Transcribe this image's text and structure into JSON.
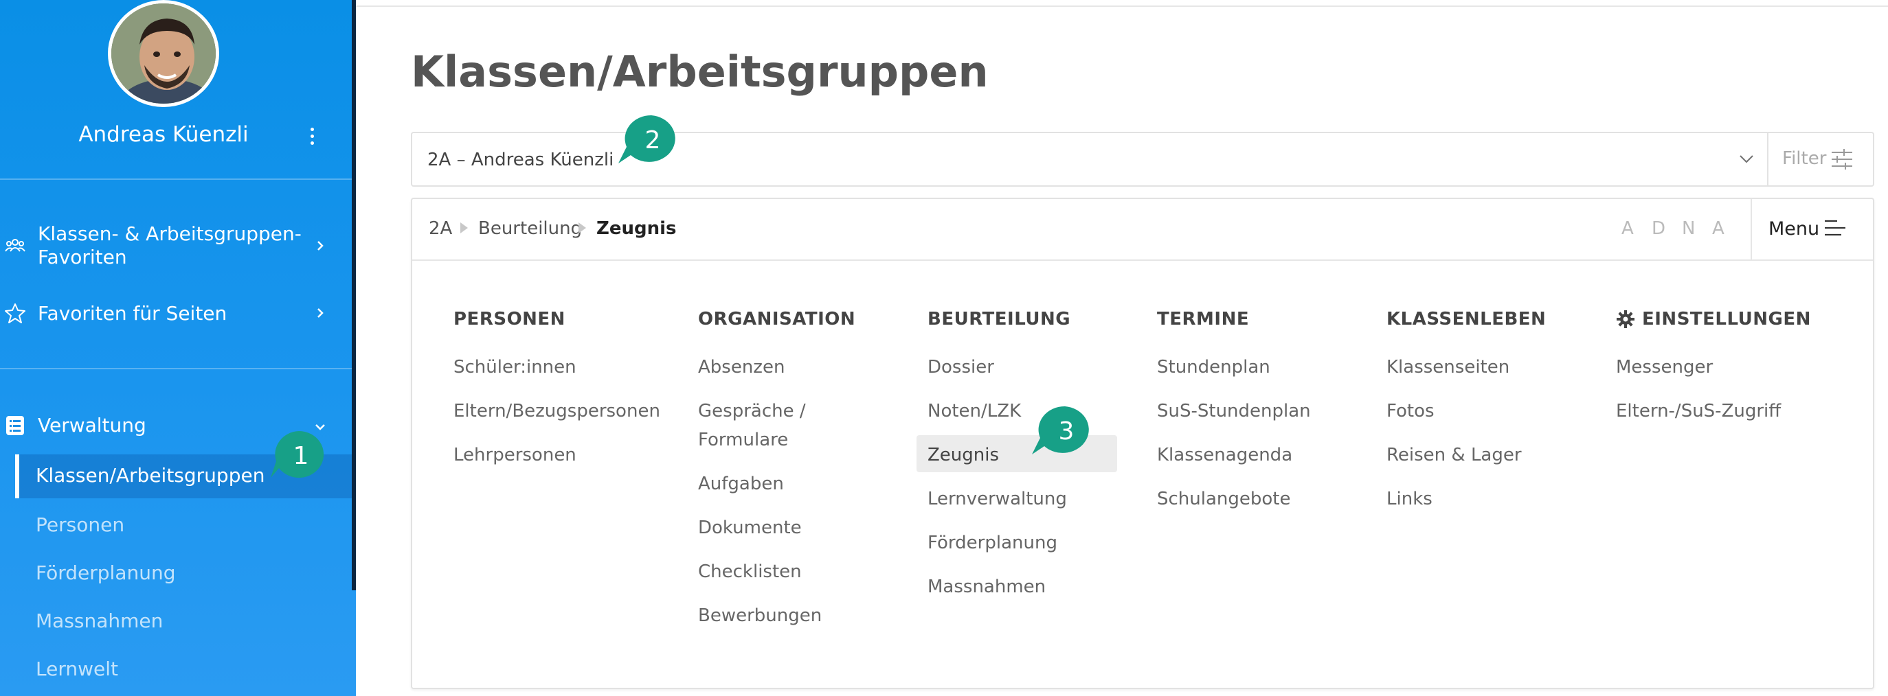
{
  "sidebar": {
    "user_name": "Andreas Küenzli",
    "nav": [
      {
        "label_line1": "Klassen- & Arbeitsgruppen-",
        "label_line2": "Favoriten",
        "icon": "users-icon"
      },
      {
        "label": "Favoriten für Seiten",
        "icon": "star-icon"
      },
      {
        "label": "Verwaltung",
        "icon": "list-icon"
      }
    ],
    "sub_items": [
      "Klassen/Arbeitsgruppen",
      "Personen",
      "Förderplanung",
      "Massnahmen",
      "Lernwelt"
    ]
  },
  "markers": [
    "1",
    "2",
    "3"
  ],
  "main": {
    "title": "Klassen/Arbeitsgruppen",
    "select_value": "2A – Andreas Küenzli",
    "filter_label": "Filter",
    "breadcrumb": [
      "2A",
      "Beurteilung",
      "Zeugnis"
    ],
    "adna": [
      "A",
      "D",
      "N",
      "A"
    ],
    "menu_label": "Menu"
  },
  "columns": [
    {
      "heading": "PERSONEN",
      "items": [
        "Schüler:innen",
        "Eltern/Bezugspersonen",
        "Lehrpersonen"
      ]
    },
    {
      "heading": "ORGANISATION",
      "items": [
        "Absenzen",
        "Gespräche /",
        "Formulare",
        "Aufgaben",
        "Dokumente",
        "Checklisten",
        "Bewerbungen"
      ]
    },
    {
      "heading": "BEURTEILUNG",
      "items": [
        "Dossier",
        "Noten/LZK",
        "Zeugnis",
        "Lernverwaltung",
        "Förderplanung",
        "Massnahmen"
      ]
    },
    {
      "heading": "TERMINE",
      "items": [
        "Stundenplan",
        "SuS-Stundenplan",
        "Klassenagenda",
        "Schulangebote"
      ]
    },
    {
      "heading": "KLASSENLEBEN",
      "items": [
        "Klassenseiten",
        "Fotos",
        "Reisen & Lager",
        "Links"
      ]
    },
    {
      "heading": "EINSTELLUNGEN",
      "items": [
        "Messenger",
        "Eltern-/SuS-Zugriff"
      ]
    }
  ],
  "colors": {
    "sidebar": "#0a8fe6",
    "accent_marker": "#17a087",
    "selected_bg": "#ececec"
  }
}
